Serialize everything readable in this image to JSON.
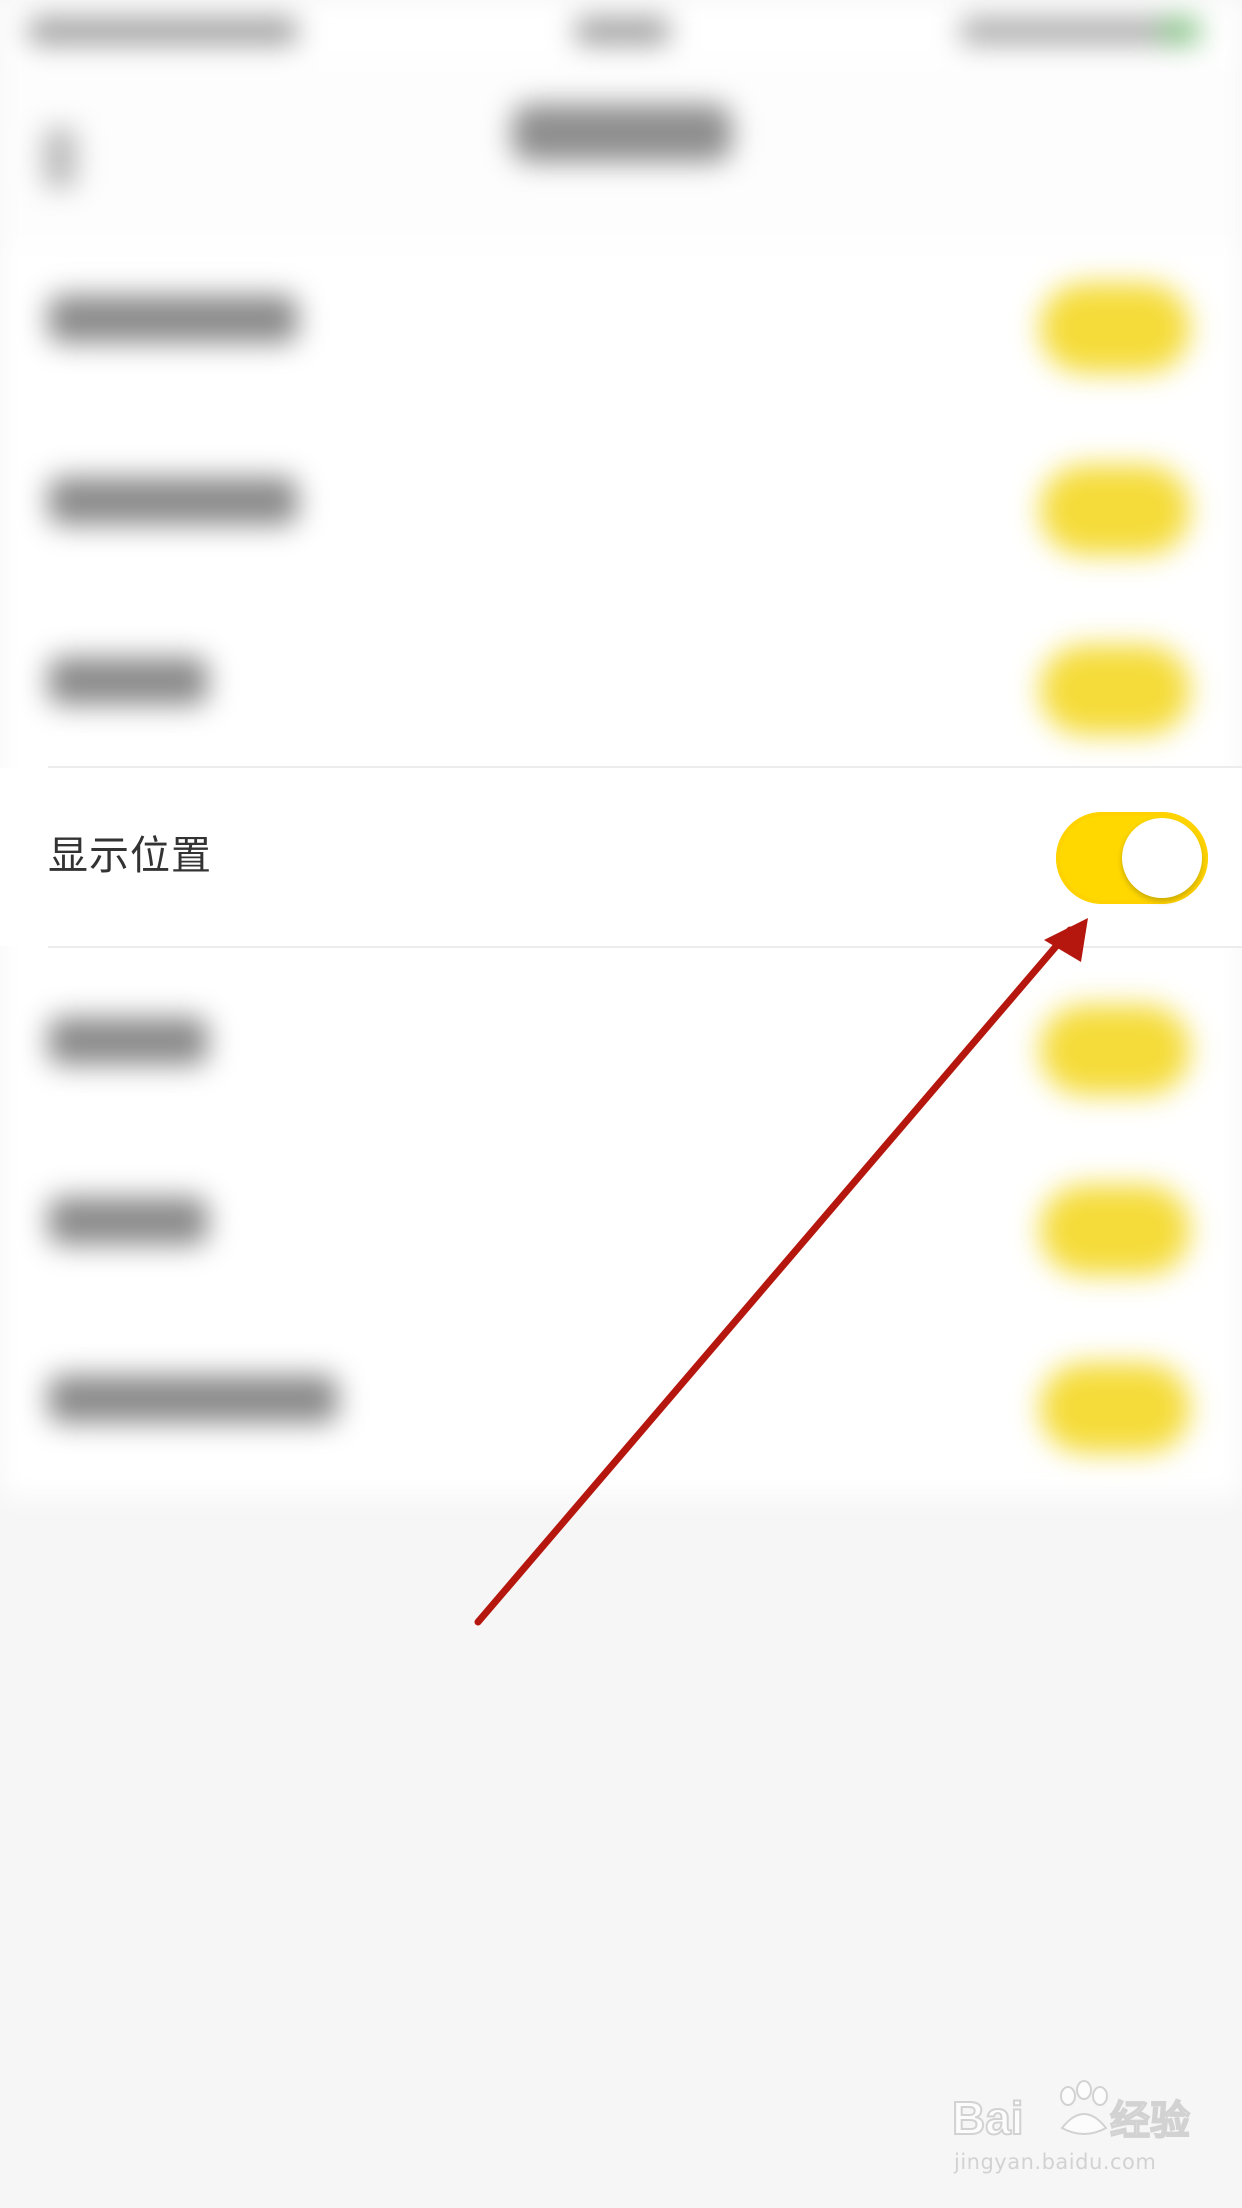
{
  "setting_row": {
    "label": "显示位置",
    "toggle_state": "on"
  },
  "watermark": {
    "logo_text": "Bai du 经验",
    "url_text": "jingyan.baidu.com"
  },
  "colors": {
    "toggle_on": "#ffd800",
    "annotation_arrow": "#b5160e",
    "row_text": "#333333",
    "page_background": "#f6f6f6"
  },
  "icons": {
    "back": "back-arrow-icon",
    "annotation": "arrow-annotation-icon",
    "watermark": "paw-logo-icon"
  }
}
